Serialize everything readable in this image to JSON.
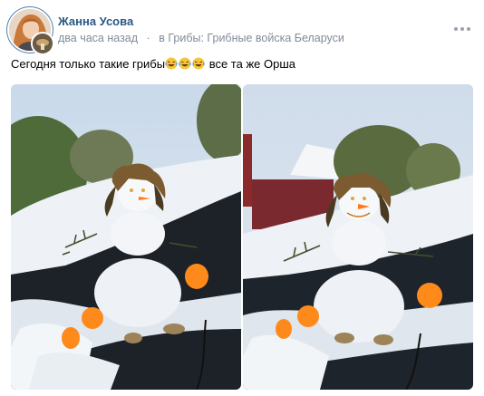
{
  "post": {
    "author": "Жанна Усова",
    "time": "два часа назад",
    "separator": "·",
    "group_prefix": "в Грибы:",
    "group_name": "Грибные войска Беларуси",
    "text_before": "Сегодня только такие грибы",
    "text_after": " все та же Орша",
    "emoji": [
      "laughing-crying-emoji",
      "laughing-crying-emoji",
      "laughing-crying-emoji"
    ],
    "colors": {
      "link": "#2a5885",
      "meta": "#818c99"
    }
  },
  "photos": [
    {
      "name": "snowman-photo-1"
    },
    {
      "name": "snowman-photo-2"
    }
  ]
}
